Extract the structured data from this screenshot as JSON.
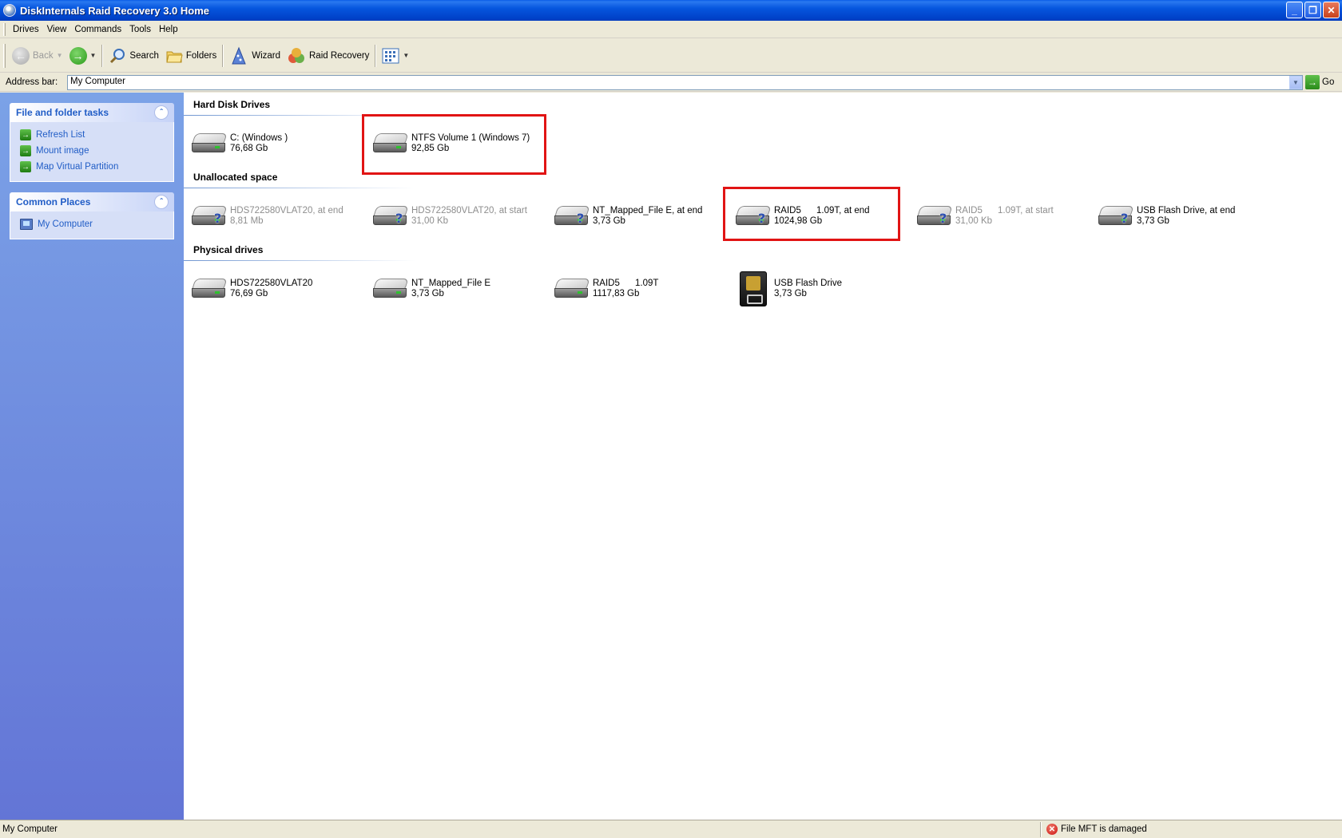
{
  "window": {
    "title": "DiskInternals Raid Recovery 3.0 Home",
    "minimize_glyph": "_",
    "maximize_glyph": "❐",
    "close_glyph": "✕"
  },
  "menu": [
    "Drives",
    "View",
    "Commands",
    "Tools",
    "Help"
  ],
  "toolbar": {
    "back_label": "Back",
    "search_label": "Search",
    "folders_label": "Folders",
    "wizard_label": "Wizard",
    "raid_recovery_label": "Raid Recovery",
    "view_icon": "view-grid-icon"
  },
  "addressbar": {
    "label": "Address bar:",
    "value": "My Computer",
    "go_label": "Go"
  },
  "leftpane": {
    "tasks_title": "File and folder tasks",
    "tasks": [
      "Refresh List",
      "Mount image",
      "Map Virtual Partition"
    ],
    "places_title": "Common Places",
    "places": [
      "My Computer"
    ]
  },
  "groups": {
    "hard_disk_drives": {
      "title": "Hard Disk Drives",
      "items": [
        {
          "name": "C: (Windows )",
          "size": "76,68 Gb",
          "icon": "hdd-icon",
          "dim": false,
          "highlighted": false
        },
        {
          "name": "NTFS Volume 1 (Windows 7)",
          "size": "92,85 Gb",
          "icon": "hdd-icon",
          "dim": false,
          "highlighted": true
        }
      ]
    },
    "unallocated_space": {
      "title": "Unallocated space",
      "items": [
        {
          "name": "HDS722580VLAT20, at end",
          "size": "8,81 Mb",
          "icon": "hdd-unknown-icon",
          "dim": true,
          "highlighted": false
        },
        {
          "name": "HDS722580VLAT20, at start",
          "size": "31,00 Kb",
          "icon": "hdd-unknown-icon",
          "dim": true,
          "highlighted": false
        },
        {
          "name": "NT_Mapped_File E, at end",
          "size": "3,73 Gb",
          "icon": "hdd-unknown-icon",
          "dim": false,
          "highlighted": false
        },
        {
          "name": "RAID5      1.09T, at end",
          "size": "1024,98 Gb",
          "icon": "hdd-unknown-icon",
          "dim": false,
          "highlighted": true
        },
        {
          "name": "RAID5      1.09T, at start",
          "size": "31,00 Kb",
          "icon": "hdd-unknown-icon",
          "dim": true,
          "highlighted": false
        },
        {
          "name": "USB Flash Drive, at end",
          "size": "3,73 Gb",
          "icon": "hdd-unknown-icon",
          "dim": false,
          "highlighted": false
        }
      ]
    },
    "physical_drives": {
      "title": "Physical drives",
      "items": [
        {
          "name": "HDS722580VLAT20",
          "size": "76,69 Gb",
          "icon": "hdd-icon",
          "dim": false,
          "highlighted": false
        },
        {
          "name": "NT_Mapped_File E",
          "size": "3,73 Gb",
          "icon": "hdd-icon",
          "dim": false,
          "highlighted": false
        },
        {
          "name": "RAID5      1.09T",
          "size": "1117,83 Gb",
          "icon": "hdd-icon",
          "dim": false,
          "highlighted": false
        },
        {
          "name": "USB Flash Drive",
          "size": "3,73 Gb",
          "icon": "flash-drive-icon",
          "dim": false,
          "highlighted": false
        }
      ]
    }
  },
  "statusbar": {
    "left": "My Computer",
    "message": "File MFT is damaged"
  },
  "colors": {
    "highlight_box": "#e11414",
    "task_link": "#215dc6",
    "dim_text": "#8d8d8d"
  }
}
